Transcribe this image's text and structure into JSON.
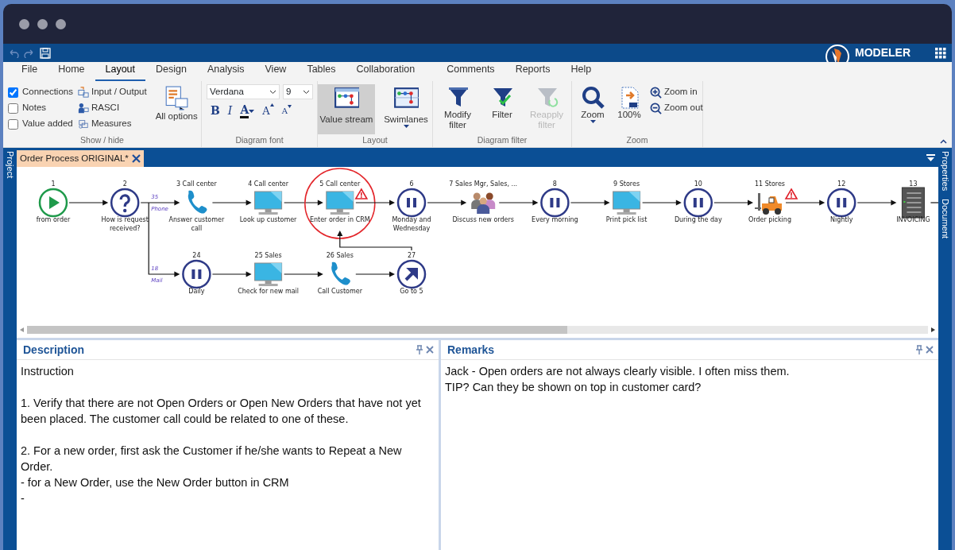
{
  "app": {
    "brand": "MODELER"
  },
  "menu_tabs": [
    {
      "label": "File",
      "selected": false
    },
    {
      "label": "Home",
      "selected": false
    },
    {
      "label": "Layout",
      "selected": true
    },
    {
      "label": "Design",
      "selected": false
    },
    {
      "label": "Analysis",
      "selected": false
    },
    {
      "label": "View",
      "selected": false
    },
    {
      "label": "Tables",
      "selected": false
    },
    {
      "label": "Collaboration",
      "selected": false
    },
    {
      "label": "Comments",
      "selected": false
    },
    {
      "label": "Reports",
      "selected": false
    },
    {
      "label": "Help",
      "selected": false
    }
  ],
  "ribbon": {
    "show_hide": {
      "title": "Show / hide",
      "checkboxes": [
        {
          "label": "Connections",
          "checked": true
        },
        {
          "label": "Notes",
          "checked": false
        },
        {
          "label": "Value added",
          "checked": false
        }
      ],
      "items": [
        {
          "label": "Input / Output",
          "kind": "input-output"
        },
        {
          "label": "RASCI",
          "kind": "rasci"
        },
        {
          "label": "Measures",
          "kind": "measures"
        }
      ],
      "all_options": "All options"
    },
    "font": {
      "title": "Diagram font",
      "family": "Verdana",
      "size": "9",
      "buttons": [
        {
          "label": "B",
          "kind": "bold"
        },
        {
          "label": "I",
          "kind": "italic"
        },
        {
          "label": "A",
          "kind": "color"
        },
        {
          "label": "A",
          "kind": "grow"
        },
        {
          "label": "A",
          "kind": "shrink"
        }
      ]
    },
    "layout": {
      "title": "Layout",
      "buttons": [
        {
          "label": "Value stream",
          "kind": "value-stream",
          "selected": true,
          "dropdown": false
        },
        {
          "label": "Swimlanes",
          "kind": "swimlanes",
          "selected": false,
          "dropdown": true
        }
      ]
    },
    "filter": {
      "title": "Diagram filter",
      "buttons": [
        {
          "label": "Modify filter",
          "kind": "funnel",
          "disabled": false
        },
        {
          "label": "Filter",
          "kind": "funnel-check",
          "disabled": false
        },
        {
          "label": "Reapply filter",
          "kind": "funnel-refresh",
          "disabled": true
        }
      ]
    },
    "zoom": {
      "title": "Zoom",
      "buttons": [
        {
          "label": "Zoom",
          "kind": "magnifier",
          "dropdown": true
        },
        {
          "label": "100%",
          "kind": "page",
          "dropdown": false
        }
      ],
      "small": [
        {
          "label": "Zoom in",
          "kind": "zoom-in"
        },
        {
          "label": "Zoom out",
          "kind": "zoom-out"
        }
      ]
    }
  },
  "sidebars": {
    "left": "Project",
    "right": [
      "Properties",
      "Document"
    ]
  },
  "document_tab": {
    "title": "Order Process ORIGINAL*"
  },
  "diagram": {
    "steps": [
      {
        "header": "1",
        "label": "from order",
        "kind": "start",
        "warning": false,
        "highlighted": false
      },
      {
        "header": "2",
        "label": "How is request received?",
        "kind": "decision",
        "warning": false,
        "highlighted": false
      },
      {
        "header": "3 Call center",
        "label": "Answer customer call",
        "kind": "phone",
        "warning": false,
        "highlighted": false
      },
      {
        "header": "4 Call center",
        "label": "Look up customer",
        "kind": "computer",
        "warning": false,
        "highlighted": false
      },
      {
        "header": "5 Call center",
        "label": "Enter order in CRM",
        "kind": "computer",
        "warning": true,
        "highlighted": true
      },
      {
        "header": "6",
        "label": "Monday and Wednesday",
        "kind": "wait",
        "warning": false,
        "highlighted": false
      },
      {
        "header": "7 Sales Mgr, Sales, ...",
        "label": "Discuss new orders",
        "kind": "people",
        "warning": false,
        "highlighted": false
      },
      {
        "header": "8",
        "label": "Every morning",
        "kind": "wait",
        "warning": false,
        "highlighted": false
      },
      {
        "header": "9 Stores",
        "label": "Print pick list",
        "kind": "computer",
        "warning": false,
        "highlighted": false
      },
      {
        "header": "10",
        "label": "During the day",
        "kind": "wait",
        "warning": false,
        "highlighted": false
      },
      {
        "header": "11 Stores",
        "label": "Order picking",
        "kind": "forklift",
        "warning": true,
        "highlighted": false
      },
      {
        "header": "12",
        "label": "Nightly",
        "kind": "wait",
        "warning": false,
        "highlighted": false
      },
      {
        "header": "13",
        "label": "INVOICING",
        "kind": "server",
        "warning": false,
        "highlighted": false
      }
    ],
    "branch": {
      "labels": [
        {
          "count": "35",
          "channel": "Phone"
        },
        {
          "count": "18",
          "channel": "Mail"
        }
      ],
      "steps": [
        {
          "header": "24",
          "label": "Daily",
          "kind": "wait",
          "warning": false,
          "highlighted": false
        },
        {
          "header": "25 Sales",
          "label": "Check for new mail",
          "kind": "computer",
          "warning": false,
          "highlighted": false
        },
        {
          "header": "26 Sales",
          "label": "Call Customer",
          "kind": "phone",
          "warning": false,
          "highlighted": false
        },
        {
          "header": "27",
          "label": "Go to 5",
          "kind": "goto",
          "warning": false,
          "highlighted": false
        }
      ]
    }
  },
  "panels": [
    {
      "title": "Description",
      "paragraphs": [
        [
          "Instruction"
        ],
        [
          "1. Verify that there are not Open Orders or Open New Orders that have not yet been placed. The customer call could be related to one of these."
        ],
        [
          "2. For a new order, first ask the Customer if he/she wants to Repeat a New Order.",
          "- for a New Order, use the New Order button in CRM",
          "-"
        ]
      ]
    },
    {
      "title": "Remarks",
      "paragraphs": [
        [
          "Jack - Open orders are not always clearly visible. I often miss them.",
          "TIP? Can they be shown on top in customer card?"
        ]
      ]
    }
  ]
}
